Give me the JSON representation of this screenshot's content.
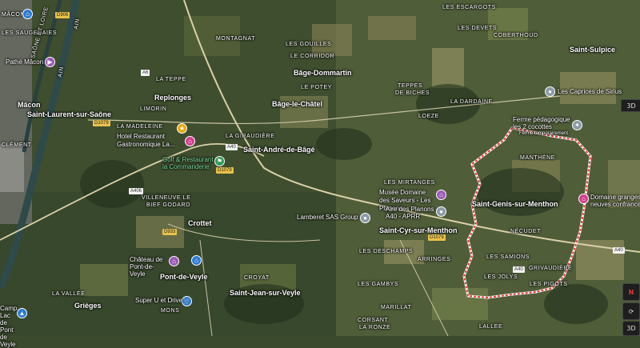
{
  "colors": {
    "boundary": "#e53935",
    "label": "#ffffff"
  },
  "places_large": [
    {
      "name": "Mâcon",
      "text": "Mâcon"
    },
    {
      "name": "Replonges",
      "text": "Replonges"
    },
    {
      "name": "Bâge-Dommartin",
      "text": "Bâge-Dommartin"
    },
    {
      "name": "Bâge-le-Châtel",
      "text": "Bâge-le-Châtel"
    },
    {
      "name": "Saint-André-de-Bâgé",
      "text": "Saint-André-de-Bâgé"
    },
    {
      "name": "Saint-Laurent-sur-Saône",
      "text": "Saint-Laurent-sur-Saône"
    },
    {
      "name": "Saint-Sulpice",
      "text": "Saint-Sulpice"
    },
    {
      "name": "Saint-Genis-sur-Menthon",
      "text": "Saint-Genis-sur-Menthon"
    },
    {
      "name": "Saint-Cyr-sur-Menthon",
      "text": "Saint-Cyr-sur-Menthon"
    },
    {
      "name": "Crottet",
      "text": "Crottet"
    },
    {
      "name": "Pont-de-Veyle",
      "text": "Pont-de-Veyle"
    },
    {
      "name": "Saint-Jean-sur-Veyle",
      "text": "Saint-Jean-sur-Veyle"
    },
    {
      "name": "Grièges",
      "text": "Grièges"
    }
  ],
  "places_small": [
    {
      "text": "MÂCON"
    },
    {
      "text": "LES SAUGERAIES"
    },
    {
      "text": "SAÔNE ET LOIRE"
    },
    {
      "text": "AIN"
    },
    {
      "text": "AIN"
    },
    {
      "text": "MONTAGNAT"
    },
    {
      "text": "LES GOUILLES"
    },
    {
      "text": "LE CORRIDOR"
    },
    {
      "text": "LA TEPPE"
    },
    {
      "text": "LE POTEY"
    },
    {
      "text": "TEPPES"
    },
    {
      "text": "DE BICHES"
    },
    {
      "text": "LES ESCARGOTS"
    },
    {
      "text": "LES DEVETS"
    },
    {
      "text": "COBERTHOUD"
    },
    {
      "text": "LA DARDAINE"
    },
    {
      "text": "LOEZE"
    },
    {
      "text": "LIMORIN"
    },
    {
      "text": "LA MADELEINE"
    },
    {
      "text": "LA GIRAUDIÈRE"
    },
    {
      "text": "CLÉMENT"
    },
    {
      "text": "MANTHÈNE"
    },
    {
      "text": "LES MIRTANGES"
    },
    {
      "text": "VILLENEUVE LE"
    },
    {
      "text": "BIEF GODARD"
    },
    {
      "text": "NÉCUDET"
    },
    {
      "text": "LES DESCHAMPS"
    },
    {
      "text": "ARRINGES"
    },
    {
      "text": "LES SAMIONS"
    },
    {
      "text": "LES JOLYS"
    },
    {
      "text": "GRIVAUDIÈRE"
    },
    {
      "text": "LES PIGOTS"
    },
    {
      "text": "LES GAMBYS"
    },
    {
      "text": "CROYAT"
    },
    {
      "text": "MARILLAT"
    },
    {
      "text": "LA VALLÉE"
    },
    {
      "text": "MONS"
    },
    {
      "text": "CORSANT"
    },
    {
      "text": "LA RONZE"
    },
    {
      "text": "LALLEE"
    }
  ],
  "pois": [
    {
      "name": "Pathé Mâcon",
      "text": "Pathé Mâcon",
      "icon": "film-icon",
      "color": "purple"
    },
    {
      "name": "Hotel Restaurant Gastronomique La...",
      "text": "Hotel Restaurant Gastronomique La...",
      "icon": "bed-icon",
      "color": "pink"
    },
    {
      "name": "Golf & Restaurant la Commanderie",
      "text": "Golf & Restaurant la Commanderie",
      "icon": "golf-icon",
      "color": "green"
    },
    {
      "name": "Les Caprices de Sirius",
      "text": "Les Caprices de Sirius",
      "icon": "pin-icon",
      "color": "grey"
    },
    {
      "name": "Ferme pédagogique les 2 cocottes",
      "text": "Ferme pédagogique les 2 cocottes",
      "sub": "Ferme temporairement",
      "icon": "farm-icon",
      "color": "grey"
    },
    {
      "name": "Domaine granges neuves confrance",
      "text": "Domaine granges neuves confrance",
      "icon": "bed-icon",
      "color": "pink"
    },
    {
      "name": "Musée Domaine des Saveurs - Les Planons",
      "text": "Musée Domaine des Saveurs - Les Planons",
      "icon": "museum-icon",
      "color": "purple"
    },
    {
      "name": "Aire des Planons A40 - APRR",
      "text": "Aire des Planons A40 - APRR",
      "icon": "pin-icon",
      "color": "grey"
    },
    {
      "name": "Lamberet SAS Group",
      "text": "Lamberet SAS Group",
      "icon": "pin-icon",
      "color": "grey"
    },
    {
      "name": "Château de Pont-de-Veyle",
      "text": "Château de Pont-de-Veyle",
      "icon": "museum-icon",
      "color": "purple"
    },
    {
      "name": "Super U et Drive",
      "text": "Super U et Drive",
      "icon": "cart-icon",
      "color": "blue"
    },
    {
      "name": "Camping Lac de Pont de Veyle",
      "text": "Camping Lac de Pont de Veyle",
      "icon": "tent-icon",
      "color": "blue"
    }
  ],
  "roads": [
    {
      "name": "D906",
      "text": "D906"
    },
    {
      "name": "A6",
      "text": "A6"
    },
    {
      "name": "D1079-a",
      "text": "D1079"
    },
    {
      "name": "A40-a",
      "text": "A40"
    },
    {
      "name": "D1079-b",
      "text": "D1079"
    },
    {
      "name": "A406",
      "text": "A406"
    },
    {
      "name": "D933",
      "text": "D933"
    },
    {
      "name": "D1079-c",
      "text": "D1079"
    },
    {
      "name": "A40-b",
      "text": "A40"
    },
    {
      "name": "A40-c",
      "text": "A40"
    }
  ],
  "controls": {
    "partial_label": "3D",
    "compass_label": "N"
  }
}
